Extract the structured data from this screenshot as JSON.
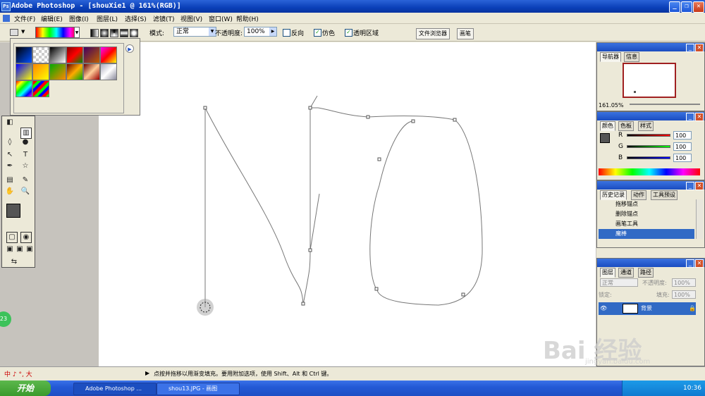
{
  "window": {
    "title": "Adobe Photoshop - [shouXie1 @ 161%(RGB)]",
    "app_icon": "photoshop-icon",
    "btn_min": "_",
    "btn_max": "❐",
    "btn_close": "✕"
  },
  "menu": [
    "文件(F)",
    "编辑(E)",
    "图像(I)",
    "图层(L)",
    "选择(S)",
    "滤镜(T)",
    "视图(V)",
    "窗口(W)",
    "帮助(H)"
  ],
  "options": {
    "mode_label": "模式:",
    "mode_value": "正常",
    "opacity_label": "不透明度:",
    "opacity_value": "100%",
    "reverse_label": "反向",
    "dither_label": "仿色",
    "transparency_label": "透明区域",
    "dither_checked": "✓",
    "transparency_checked": "✓",
    "file_browser_tab": "文件浏览器",
    "brushes_tab": "画笔"
  },
  "navigator": {
    "tab1": "导航器",
    "tab2": "信息",
    "zoom": "161.05%"
  },
  "color_panel": {
    "tab1": "颜色",
    "tab2": "色板",
    "tab3": "样式",
    "r_label": "R",
    "g_label": "G",
    "b_label": "B",
    "r": "100",
    "g": "100",
    "b": "100"
  },
  "history": {
    "tab1": "历史记录",
    "tab2": "动作",
    "tab3": "工具预设",
    "items": [
      "拖移锚点",
      "删除锚点",
      "画笔工具",
      "魔棒"
    ]
  },
  "layers": {
    "tab1": "图层",
    "tab2": "通道",
    "tab3": "路径",
    "blend": "正常",
    "opacity_label": "不透明度:",
    "opacity": "100%",
    "lock_label": "锁定:",
    "fill_label": "填充:",
    "fill": "100%",
    "layer_name": "背景"
  },
  "status_text": "点按并拖移以用渐变填充。要用附加选项，使用 Shift、Alt 和 Ctrl 键。",
  "ime": "中 ♪ °, 大",
  "side_badge": "23",
  "taskbar": {
    "start": "开始",
    "task1": "Adobe Photoshop ...",
    "task2": "shou13.JPG - 画图",
    "clock": "10:36"
  },
  "watermark": {
    "logo": "Bai 经验",
    "url": "jingyan.baidu.com"
  },
  "colors": {
    "titlebar": "#0a3fb8",
    "selection": "#316ac5",
    "foreground": "#555555",
    "background": "#0000c8"
  }
}
